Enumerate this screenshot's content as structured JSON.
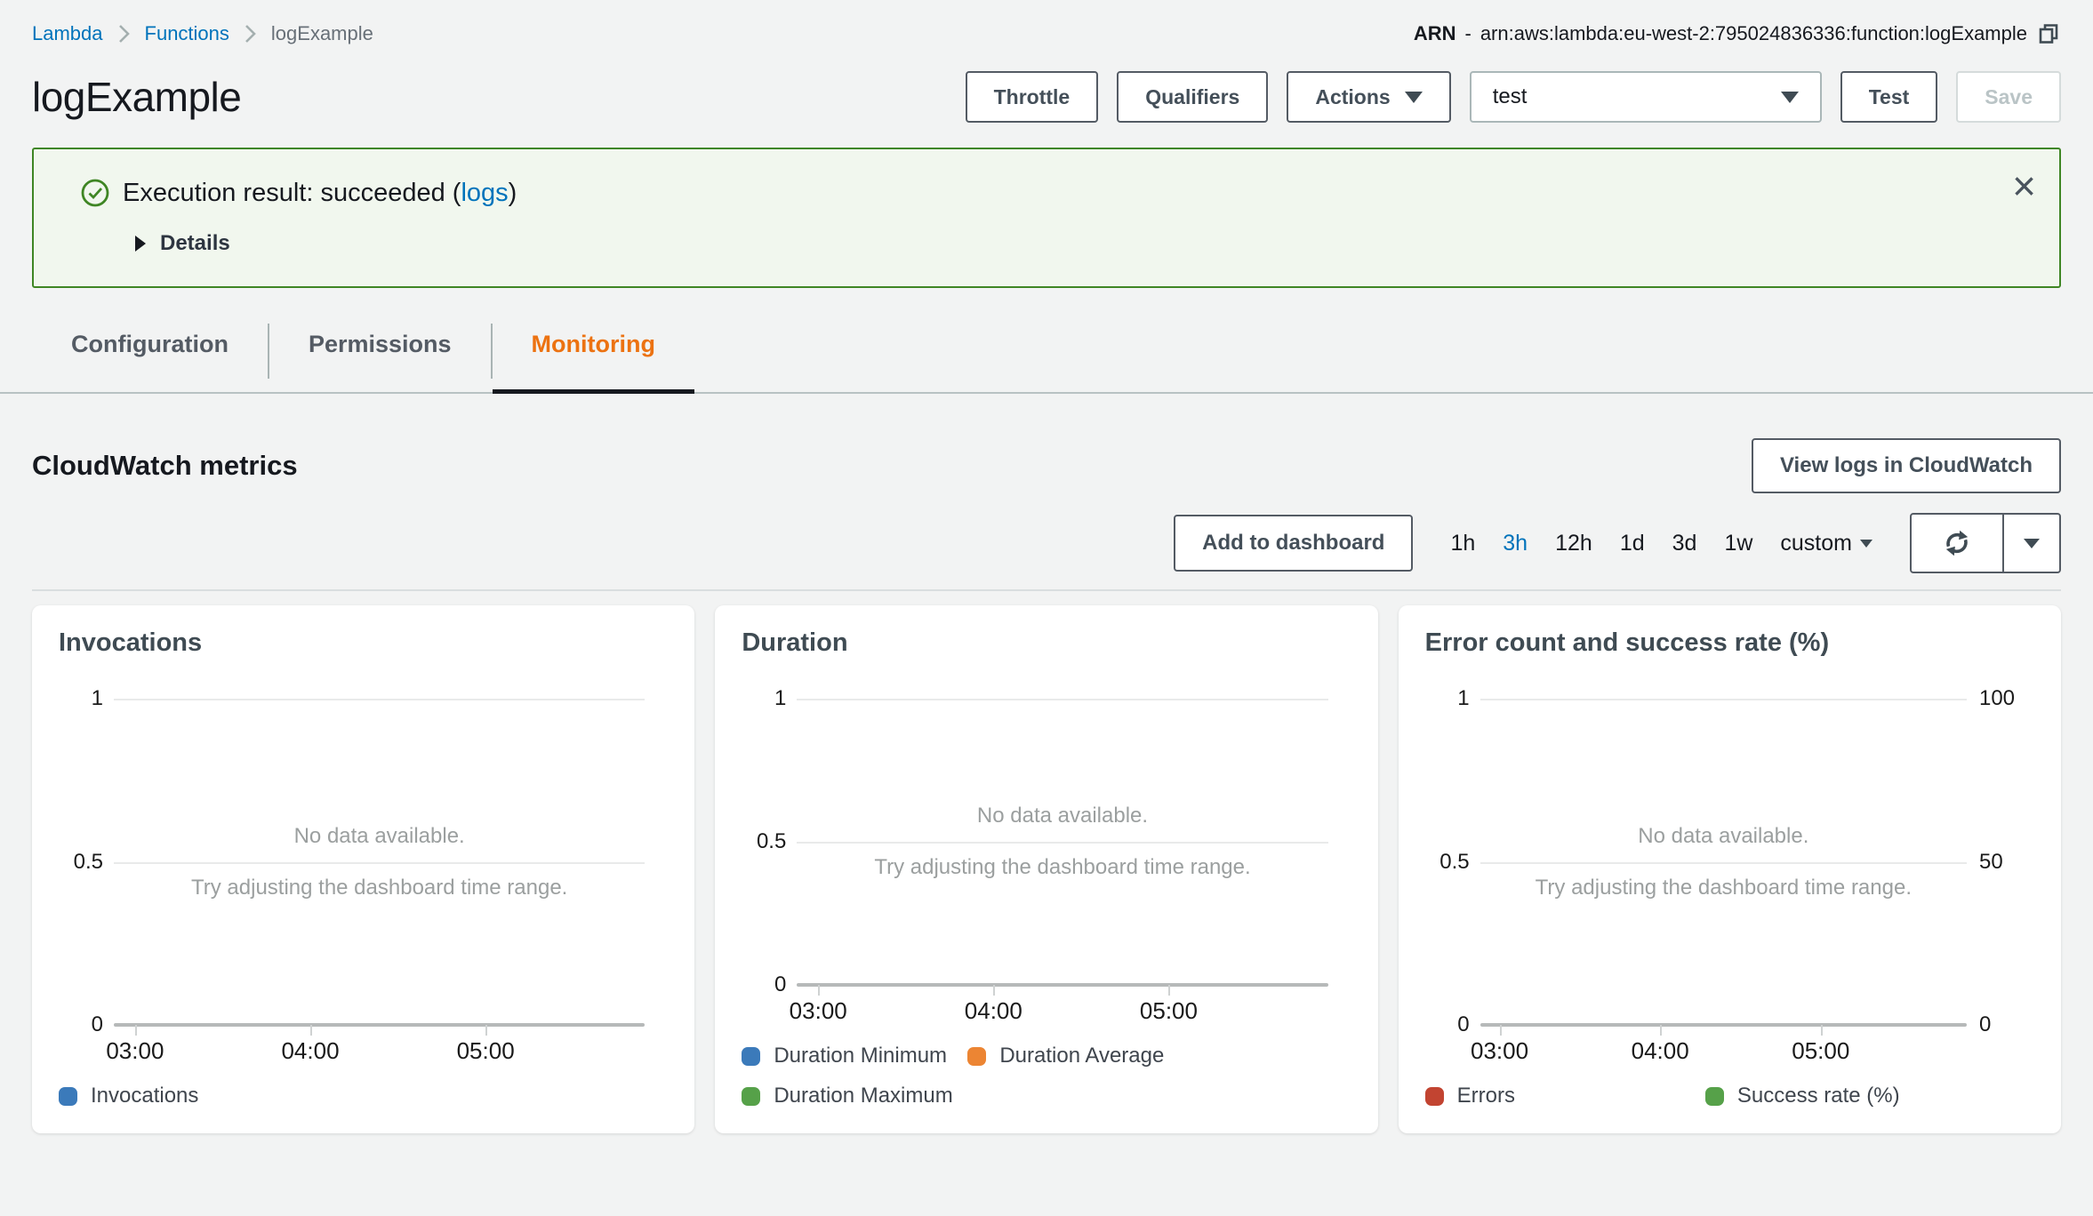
{
  "breadcrumb": {
    "items": [
      {
        "label": "Lambda"
      },
      {
        "label": "Functions"
      },
      {
        "label": "logExample"
      }
    ]
  },
  "arn": {
    "label": "ARN",
    "separator": "-",
    "value": "arn:aws:lambda:eu-west-2:795024836336:function:logExample"
  },
  "header": {
    "title": "logExample"
  },
  "toolbar": {
    "throttle": "Throttle",
    "qualifiers": "Qualifiers",
    "actions": "Actions",
    "alias_selected": "test",
    "test": "Test",
    "save": "Save"
  },
  "banner": {
    "prefix": "Execution result: succeeded (",
    "link_text": "logs",
    "suffix": ")",
    "details_label": "Details"
  },
  "tabs": [
    {
      "label": "Configuration"
    },
    {
      "label": "Permissions"
    },
    {
      "label": "Monitoring"
    }
  ],
  "metrics": {
    "heading": "CloudWatch metrics",
    "view_logs_button": "View logs in CloudWatch",
    "add_to_dashboard_button": "Add to dashboard",
    "time_ranges": [
      {
        "label": "1h"
      },
      {
        "label": "3h",
        "active": true
      },
      {
        "label": "12h"
      },
      {
        "label": "1d"
      },
      {
        "label": "3d"
      },
      {
        "label": "1w"
      },
      {
        "label": "custom"
      }
    ]
  },
  "charts": {
    "empty_state": {
      "line1": "No data available.",
      "line2": "Try adjusting the dashboard time range."
    },
    "x_ticks": [
      "03:00",
      "04:00",
      "05:00"
    ],
    "cards": [
      {
        "title": "Invocations",
        "type": "line",
        "y_ticks": [
          "1",
          "0.5",
          "0"
        ],
        "series": [],
        "legend": [
          {
            "label": "Invocations",
            "color": "#3b7aba"
          }
        ]
      },
      {
        "title": "Duration",
        "type": "line",
        "y_ticks": [
          "1",
          "0.5",
          "0"
        ],
        "series": [],
        "legend": [
          {
            "label": "Duration Minimum",
            "color": "#3b7aba"
          },
          {
            "label": "Duration Average",
            "color": "#ec8533"
          },
          {
            "label": "Duration Maximum",
            "color": "#56a149"
          }
        ]
      },
      {
        "title": "Error count and success rate (%)",
        "type": "line",
        "y_ticks": [
          "1",
          "0.5",
          "0"
        ],
        "y_ticks_right": [
          "100",
          "50",
          "0"
        ],
        "series": [],
        "legend": [
          {
            "label": "Errors",
            "color": "#c24431"
          },
          {
            "label": "Success rate (%)",
            "color": "#56a149"
          }
        ]
      }
    ]
  },
  "colors": {
    "accent_orange": "#ec7211",
    "link_blue": "#0073bb",
    "success_green": "#3f8624"
  }
}
